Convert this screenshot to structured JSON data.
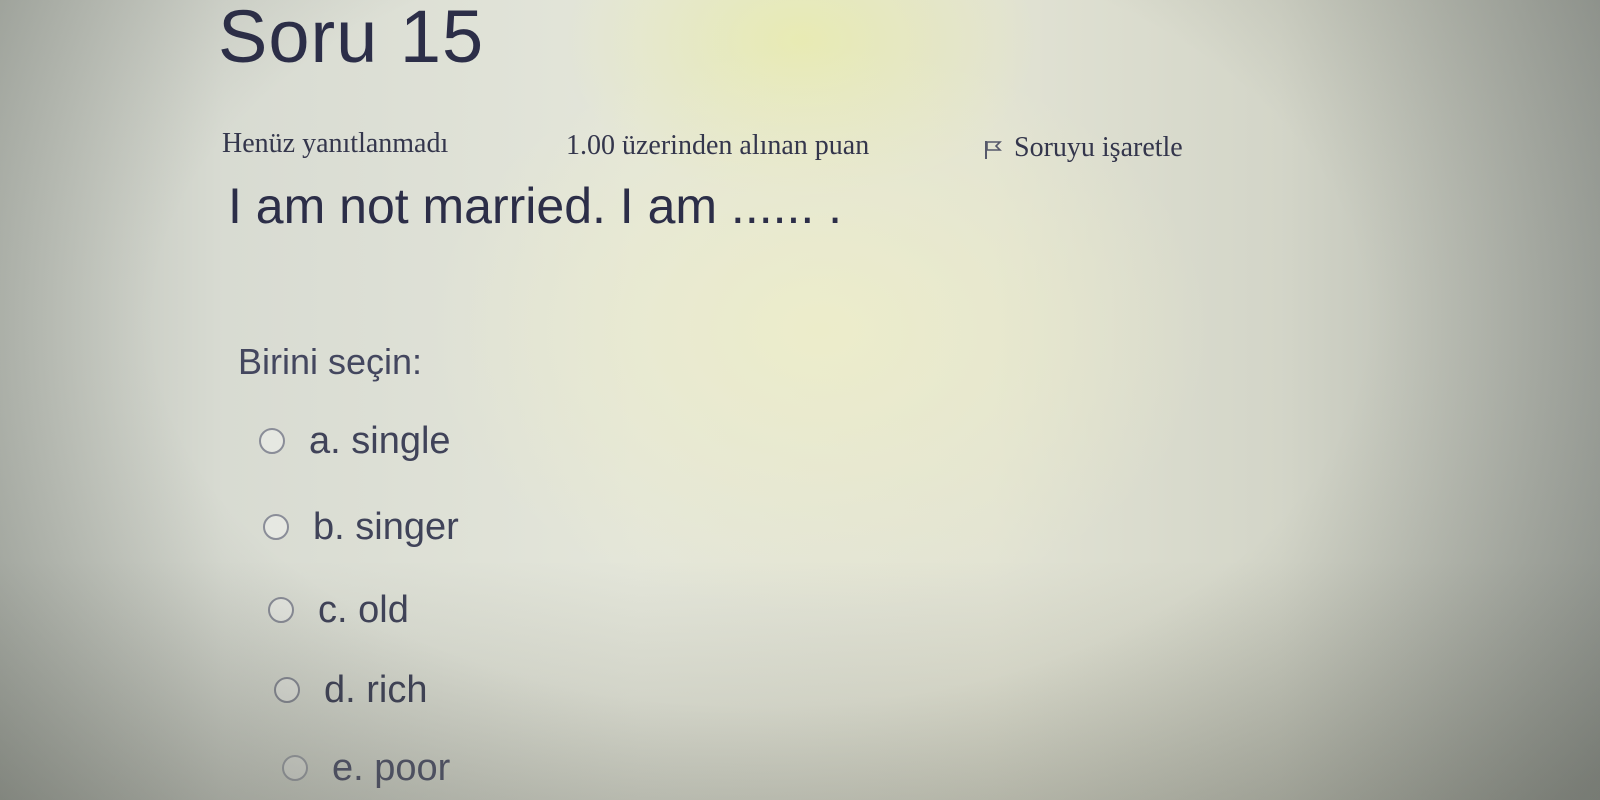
{
  "question": {
    "title": "Soru 15",
    "state": "Henüz yanıtlanmadı",
    "grade": "1.00 üzerinden alınan puan",
    "flag_label": "Soruyu işaretle",
    "flag_icon": "flag-icon",
    "text": "I am not married. I am ...... ."
  },
  "answers": {
    "prompt": "Birini seçin:",
    "options": [
      {
        "label": "a. single",
        "selected": false
      },
      {
        "label": "b. singer",
        "selected": false
      },
      {
        "label": "c. old",
        "selected": false
      },
      {
        "label": "d. rich",
        "selected": false
      },
      {
        "label": "e. poor",
        "selected": false
      }
    ]
  },
  "colors": {
    "text": "#2c2e48",
    "radio_border": "#8a8d98"
  }
}
